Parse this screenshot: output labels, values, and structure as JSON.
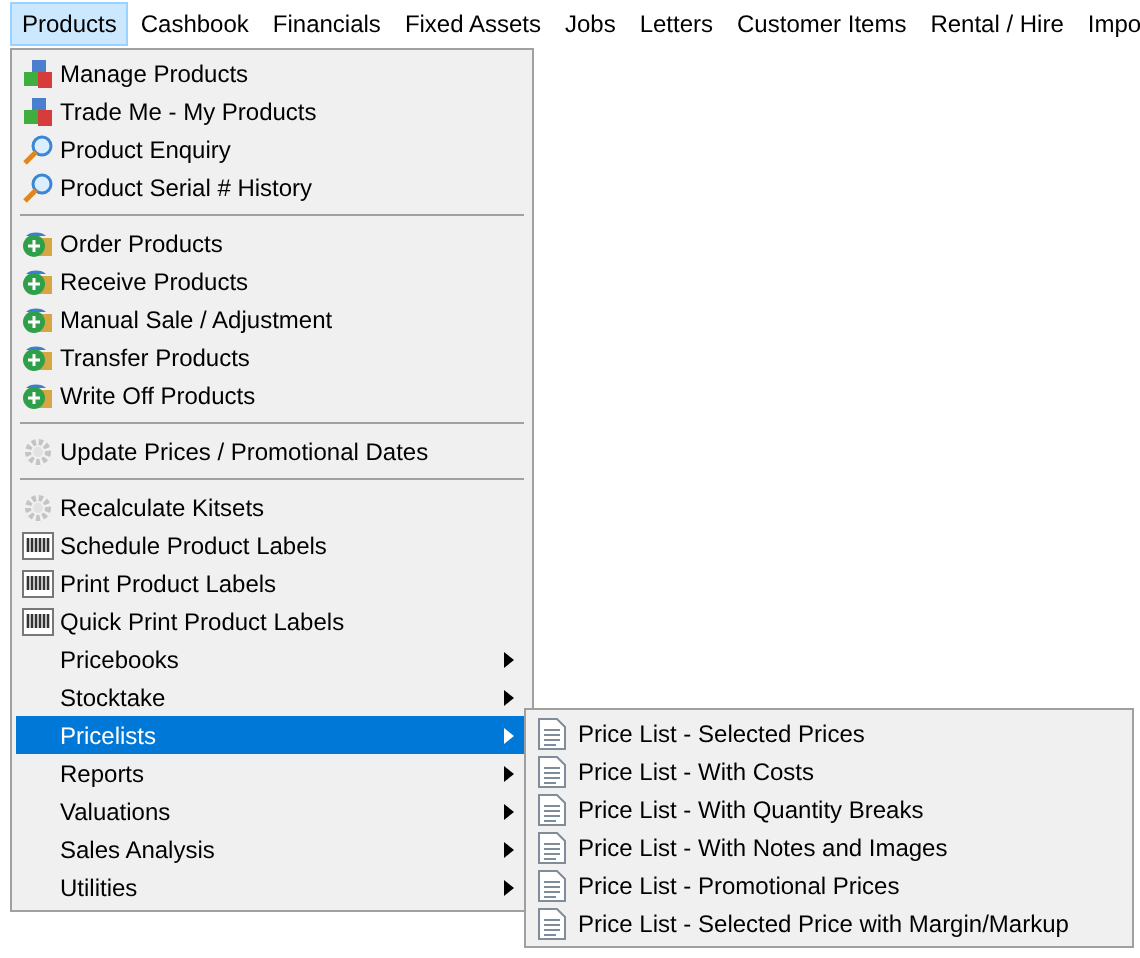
{
  "menubar": [
    {
      "label": "Products",
      "selected": true
    },
    {
      "label": "Cashbook",
      "selected": false
    },
    {
      "label": "Financials",
      "selected": false
    },
    {
      "label": "Fixed Assets",
      "selected": false
    },
    {
      "label": "Jobs",
      "selected": false
    },
    {
      "label": "Letters",
      "selected": false
    },
    {
      "label": "Customer Items",
      "selected": false
    },
    {
      "label": "Rental / Hire",
      "selected": false
    },
    {
      "label": "Impo",
      "selected": false
    }
  ],
  "menu": [
    {
      "kind": "cubes",
      "label": "Manage Products",
      "selected": false
    },
    {
      "kind": "cubes",
      "label": "Trade Me - My Products",
      "selected": false
    },
    {
      "kind": "search",
      "label": "Product Enquiry",
      "selected": false
    },
    {
      "kind": "search",
      "label": "Product Serial # History",
      "selected": false
    },
    {
      "kind": "separator"
    },
    {
      "kind": "globe",
      "label": "Order Products",
      "selected": false
    },
    {
      "kind": "globe",
      "label": "Receive Products",
      "selected": false
    },
    {
      "kind": "globe",
      "label": "Manual Sale / Adjustment",
      "selected": false
    },
    {
      "kind": "globe",
      "label": "Transfer Products",
      "selected": false
    },
    {
      "kind": "globe",
      "label": "Write Off Products",
      "selected": false
    },
    {
      "kind": "separator"
    },
    {
      "kind": "gear",
      "label": "Update Prices / Promotional Dates",
      "selected": false
    },
    {
      "kind": "separator"
    },
    {
      "kind": "gear",
      "label": "Recalculate Kitsets",
      "selected": false
    },
    {
      "kind": "barcode",
      "label": "Schedule Product Labels",
      "selected": false
    },
    {
      "kind": "barcode",
      "label": "Print Product Labels",
      "selected": false
    },
    {
      "kind": "barcode",
      "label": "Quick Print Product Labels",
      "selected": false
    },
    {
      "kind": "submenu",
      "label": "Pricebooks",
      "selected": false
    },
    {
      "kind": "submenu",
      "label": "Stocktake",
      "selected": false
    },
    {
      "kind": "submenu",
      "label": "Pricelists",
      "selected": true
    },
    {
      "kind": "submenu",
      "label": "Reports",
      "selected": false
    },
    {
      "kind": "submenu",
      "label": "Valuations",
      "selected": false
    },
    {
      "kind": "submenu",
      "label": "Sales Analysis",
      "selected": false
    },
    {
      "kind": "submenu",
      "label": "Utilities",
      "selected": false
    }
  ],
  "submenu": [
    {
      "kind": "document",
      "label": "Price List - Selected Prices"
    },
    {
      "kind": "document",
      "label": "Price List - With Costs"
    },
    {
      "kind": "document",
      "label": "Price List - With Quantity Breaks"
    },
    {
      "kind": "document",
      "label": "Price List - With Notes and Images"
    },
    {
      "kind": "document",
      "label": "Price List - Promotional Prices"
    },
    {
      "kind": "document",
      "label": "Price List - Selected Price with Margin/Markup"
    }
  ]
}
